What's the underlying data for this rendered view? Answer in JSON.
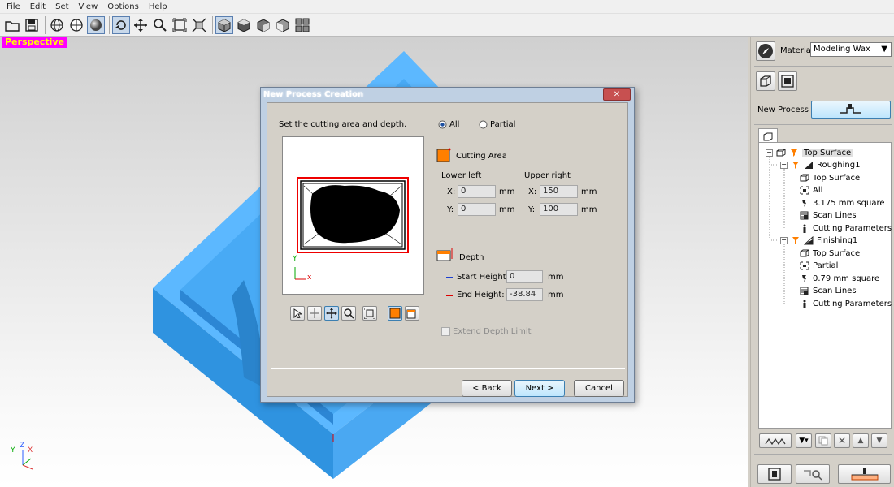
{
  "menu": [
    "File",
    "Edit",
    "Set",
    "View",
    "Options",
    "Help"
  ],
  "viewport": {
    "label": "Perspective"
  },
  "axes": {
    "x": "X",
    "y": "Y",
    "z": "Z"
  },
  "dialog": {
    "title": "New Process Creation",
    "instruction": "Set the cutting area and depth.",
    "area_mode": {
      "all": "All",
      "partial": "Partial",
      "selected": "All"
    },
    "cutting_area": {
      "title": "Cutting Area",
      "lower_left": "Lower left",
      "upper_right": "Upper right",
      "x_label": "X:",
      "y_label": "Y:",
      "ll_x": "0",
      "ll_y": "0",
      "ur_x": "150",
      "ur_y": "100",
      "unit": "mm"
    },
    "depth": {
      "title": "Depth",
      "start_label": "Start Height:",
      "start_value": "0",
      "end_label": "End Height:",
      "end_value": "-38.84",
      "unit": "mm"
    },
    "extend_depth": "Extend Depth Limit",
    "preview_axis": {
      "x": "x",
      "y": "Y"
    },
    "buttons": {
      "back": "< Back",
      "next": "Next >",
      "cancel": "Cancel"
    }
  },
  "sidebar": {
    "material_label": "Material",
    "material_value": "Modeling Wax",
    "new_process": "New Process",
    "tree": [
      {
        "label": "Top Surface",
        "level": 0,
        "icon": "surface-icon"
      },
      {
        "label": "Roughing1",
        "level": 1,
        "icon": "roughing-icon"
      },
      {
        "label": "Top Surface",
        "level": 2,
        "icon": "surface-icon"
      },
      {
        "label": "All",
        "level": 2,
        "icon": "area-icon"
      },
      {
        "label": "3.175 mm square",
        "level": 2,
        "icon": "tool-icon"
      },
      {
        "label": "Scan Lines",
        "level": 2,
        "icon": "scan-lines-icon"
      },
      {
        "label": "Cutting Parameters",
        "level": 2,
        "icon": "parameters-icon"
      },
      {
        "label": "Finishing1",
        "level": 1,
        "icon": "finishing-icon"
      },
      {
        "label": "Top Surface",
        "level": 2,
        "icon": "surface-icon"
      },
      {
        "label": "Partial",
        "level": 2,
        "icon": "area-icon"
      },
      {
        "label": "0.79 mm square",
        "level": 2,
        "icon": "tool-icon"
      },
      {
        "label": "Scan Lines",
        "level": 2,
        "icon": "scan-lines-icon"
      },
      {
        "label": "Cutting Parameters",
        "level": 2,
        "icon": "parameters-icon"
      }
    ]
  },
  "colors": {
    "model": "#3fa9f5",
    "accent": "#ff7f00",
    "highlight": "#ff00ff"
  }
}
